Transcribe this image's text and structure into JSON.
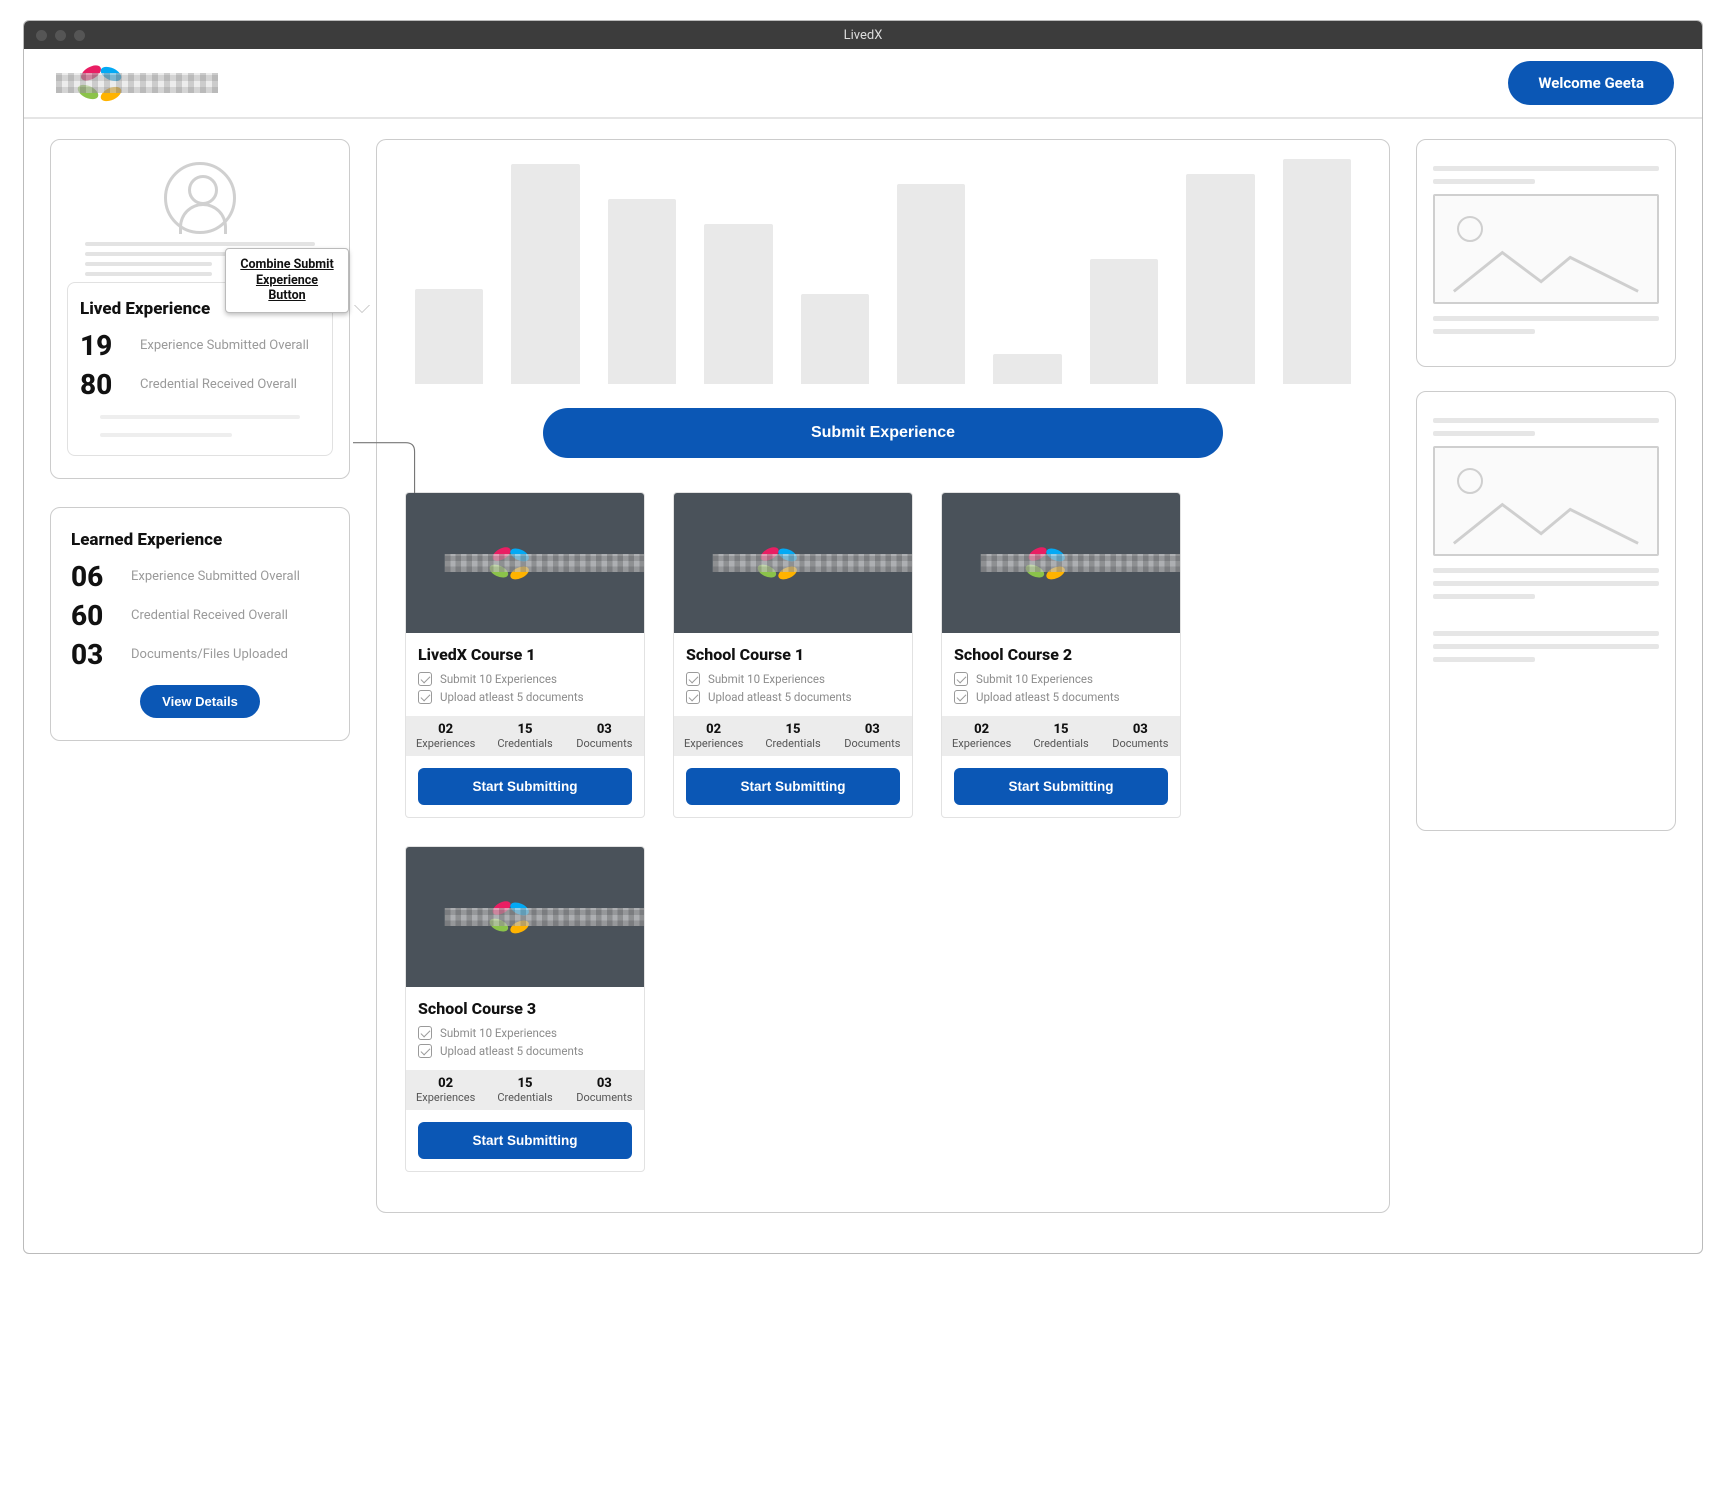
{
  "window": {
    "title": "LivedX"
  },
  "header": {
    "welcome": "Welcome Geeta"
  },
  "callout": {
    "text": "Combine Submit Experience Button"
  },
  "sidebar": {
    "lived": {
      "title": "Lived Experience",
      "stats": [
        {
          "num": "19",
          "label": "Experience Submitted Overall"
        },
        {
          "num": "80",
          "label": "Credential Received Overall"
        }
      ]
    },
    "learned": {
      "title": "Learned Experience",
      "stats": [
        {
          "num": "06",
          "label": "Experience Submitted Overall"
        },
        {
          "num": "60",
          "label": "Credential Received Overall"
        },
        {
          "num": "03",
          "label": "Documents/Files Uploaded"
        }
      ],
      "button": "View Details"
    }
  },
  "main": {
    "submit_button": "Submit Experience",
    "req1": "Submit 10 Experiences",
    "req2": "Upload atleast 5 documents",
    "metric_labels": {
      "exp": "Experiences",
      "cred": "Credentials",
      "doc": "Documents"
    },
    "course_button": "Start Submitting",
    "courses": [
      {
        "title": "LivedX Course 1",
        "exp": "02",
        "cred": "15",
        "doc": "03"
      },
      {
        "title": "School Course 1",
        "exp": "02",
        "cred": "15",
        "doc": "03"
      },
      {
        "title": "School Course 2",
        "exp": "02",
        "cred": "15",
        "doc": "03"
      },
      {
        "title": "School Course 3",
        "exp": "02",
        "cred": "15",
        "doc": "03"
      }
    ]
  },
  "chart_data": {
    "type": "bar",
    "title": "",
    "xlabel": "",
    "ylabel": "",
    "categories": [
      "",
      "",
      "",
      "",
      "",
      "",
      "",
      "",
      ""
    ],
    "values": [
      95,
      220,
      185,
      160,
      90,
      200,
      30,
      125,
      210,
      225
    ],
    "ylim": [
      0,
      230
    ],
    "note": "bars are unlabeled placeholders; values are pixel heights read from the mock"
  }
}
